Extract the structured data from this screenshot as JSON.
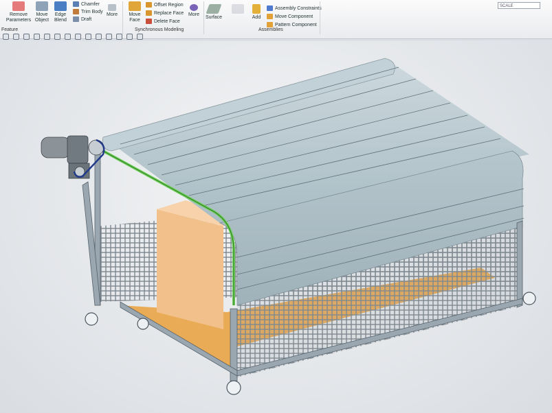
{
  "ribbon": {
    "feature_group": "Feature",
    "remove_parameters": "Remove Parameters",
    "move_object": "Move Object",
    "edge_blend": "Edge Blend",
    "chamfer": "Chamfer",
    "trim_body": "Trim Body",
    "draft": "Draft",
    "more_1": "More",
    "move_face": "Move Face",
    "offset_region": "Offset Region",
    "replace_face": "Replace Face",
    "delete_face": "Delete Face",
    "synchronous_group": "Synchronous Modeling",
    "more_2": "More",
    "surface": "Surface",
    "add": "Add",
    "assembly_constraints": "Assembly Constraints",
    "move_component": "Move Component",
    "pattern_component": "Pattern Component",
    "assemblies_group": "Assemblies",
    "search_value": "SCALE"
  },
  "colors": {
    "cover": "#b9c9d0",
    "frame": "#9aa7b0",
    "belt_guide": "#6fcf5a",
    "box": "#f2c08a",
    "floor": "#eaa03c",
    "mesh": "#7d868d"
  }
}
